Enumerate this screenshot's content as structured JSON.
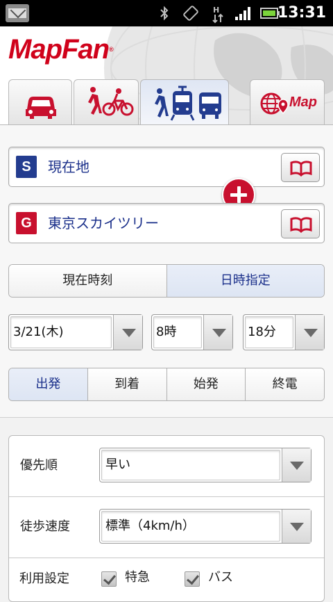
{
  "status_bar": {
    "time": "13:31",
    "icons": [
      "mail-notification-icon",
      "bluetooth-icon",
      "rotation-icon",
      "hspa-data-icon",
      "signal-icon",
      "battery-icon"
    ]
  },
  "app": {
    "logo_text": "MapFan",
    "logo_mark": "®",
    "brand_color": "#d0021b"
  },
  "tabs": [
    {
      "name": "car",
      "icon": "car-icon",
      "active": false
    },
    {
      "name": "walk-bike",
      "icon": "walk-bike-icon",
      "active": false
    },
    {
      "name": "transit",
      "icon": "transit-icon",
      "active": true
    },
    {
      "name": "map",
      "icon": "map-pin-icon",
      "label": "Map",
      "active": false
    }
  ],
  "route": {
    "start": {
      "badge": "S",
      "label": "現在地",
      "color": "#233c8f"
    },
    "goal": {
      "badge": "G",
      "label": "東京スカイツリー",
      "color": "#c8102e"
    }
  },
  "time_mode": {
    "options": [
      "現在時刻",
      "日時指定"
    ],
    "selected": "日時指定"
  },
  "datetime": {
    "date": "3/21(木)",
    "hour": "8時",
    "minute": "18分"
  },
  "direction": {
    "options": [
      "出発",
      "到着",
      "始発",
      "終電"
    ],
    "selected": "出発"
  },
  "settings": {
    "priority_label": "優先順",
    "priority_value": "早い",
    "walk_speed_label": "徒歩速度",
    "walk_speed_value": "標準（4km/h）",
    "usage_label": "利用設定",
    "usage_options": [
      "特急",
      "バス"
    ]
  }
}
